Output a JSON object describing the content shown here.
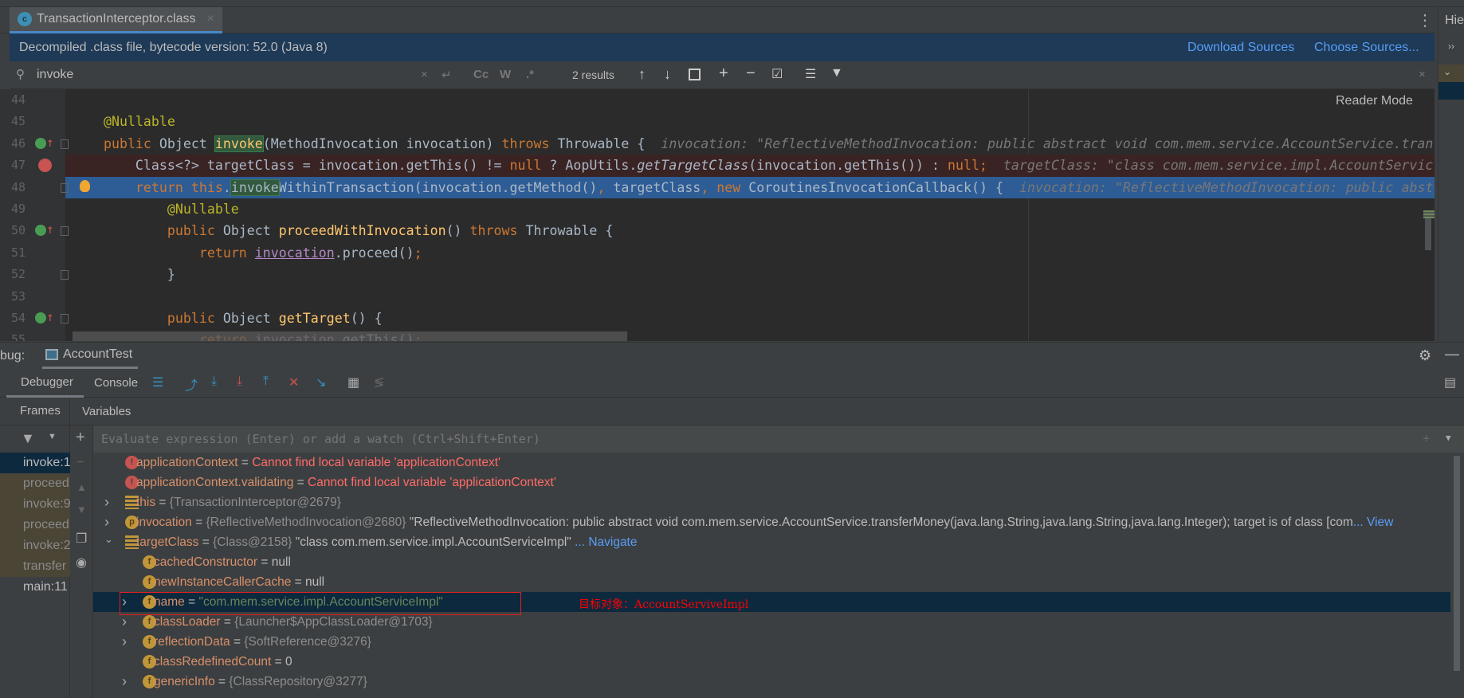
{
  "editor": {
    "tab_label": "TransactionInterceptor.class",
    "tab_close": "×",
    "info": "Decompiled .class file, bytecode version: 52.0 (Java 8)",
    "download_sources": "Download Sources",
    "choose_sources": "Choose Sources...",
    "search_value": "invoke",
    "search_results": "2 results",
    "match_case": "Cc",
    "words": "W",
    "regex": ".*",
    "reader_mode": "Reader Mode",
    "lines": [
      {
        "n": "44",
        "tokens": []
      },
      {
        "n": "45",
        "tokens": [
          {
            "c": "ann",
            "v": "    @Nullable"
          }
        ]
      },
      {
        "n": "46",
        "icon": "implements",
        "fold": true,
        "tokens": [
          {
            "c": "tx",
            "v": "    "
          },
          {
            "c": "kw",
            "v": "public "
          },
          {
            "c": "tx",
            "v": "Object "
          },
          {
            "c": "fn hl",
            "v": "invoke"
          },
          {
            "c": "tx",
            "v": "(MethodInvocation invocation) "
          },
          {
            "c": "kw",
            "v": "throws "
          },
          {
            "c": "tx",
            "v": "Throwable {"
          }
        ],
        "hint": "invocation: \"ReflectiveMethodInvocation: public abstract void com.mem.service.AccountService.tran"
      },
      {
        "n": "47",
        "icon": "breakpoint",
        "bg": "#3a2323",
        "tokens": [
          {
            "c": "tx",
            "v": "        Class<?> targetClass = invocation.getThis() != "
          },
          {
            "c": "kw",
            "v": "null"
          },
          {
            "c": "tx",
            "v": " ? AopUtils."
          },
          {
            "c": "it",
            "v": "getTargetClass"
          },
          {
            "c": "tx",
            "v": "(invocation.getThis()) : "
          },
          {
            "c": "kw",
            "v": "null;"
          }
        ],
        "hint": "targetClass: \"class com.mem.service.impl.AccountServic"
      },
      {
        "n": "48",
        "icon": "bulb",
        "fold": true,
        "bg": "#2e5c95",
        "tokens": [
          {
            "c": "tx",
            "v": "        "
          },
          {
            "c": "kw",
            "v": "return this"
          },
          {
            "c": "tx",
            "v": "."
          },
          {
            "c": "tx hl",
            "v": "invoke"
          },
          {
            "c": "tx",
            "v": "WithinTransaction(invocation.getMethod()"
          },
          {
            "c": "kw",
            "v": ", "
          },
          {
            "c": "tx",
            "v": "targetClass"
          },
          {
            "c": "kw",
            "v": ", new "
          },
          {
            "c": "tx",
            "v": "CoroutinesInvocationCallback() {"
          }
        ],
        "hint": "invocation: \"ReflectiveMethodInvocation: public abst"
      },
      {
        "n": "49",
        "tokens": [
          {
            "c": "ann",
            "v": "            @Nullable"
          }
        ]
      },
      {
        "n": "50",
        "icon": "implements",
        "fold": true,
        "tokens": [
          {
            "c": "tx",
            "v": "            "
          },
          {
            "c": "kw",
            "v": "public "
          },
          {
            "c": "tx",
            "v": "Object "
          },
          {
            "c": "fn",
            "v": "proceedWithInvocation"
          },
          {
            "c": "tx",
            "v": "() "
          },
          {
            "c": "kw",
            "v": "throws "
          },
          {
            "c": "tx",
            "v": "Throwable {"
          }
        ]
      },
      {
        "n": "51",
        "tokens": [
          {
            "c": "tx",
            "v": "                "
          },
          {
            "c": "kw",
            "v": "return "
          },
          {
            "c": "pu",
            "v": "invocation"
          },
          {
            "c": "tx",
            "v": ".proceed()"
          },
          {
            "c": "kw",
            "v": ";"
          }
        ]
      },
      {
        "n": "52",
        "fold": true,
        "tokens": [
          {
            "c": "tx",
            "v": "            }"
          }
        ]
      },
      {
        "n": "53",
        "tokens": []
      },
      {
        "n": "54",
        "icon": "implements",
        "fold": true,
        "tokens": [
          {
            "c": "tx",
            "v": "            "
          },
          {
            "c": "kw",
            "v": "public "
          },
          {
            "c": "tx",
            "v": "Object "
          },
          {
            "c": "fn",
            "v": "getTarget"
          },
          {
            "c": "tx",
            "v": "() {"
          }
        ]
      },
      {
        "n": "55",
        "tokens": [
          {
            "c": "tx",
            "v": "                "
          },
          {
            "c": "kw",
            "v": "return "
          },
          {
            "c": "pu",
            "v": "invocation"
          },
          {
            "c": "tx",
            "v": ".getThis()"
          },
          {
            "c": "kw",
            "v": ";"
          }
        ]
      }
    ]
  },
  "right_panel": {
    "title": "Hie",
    "chevrons": "››"
  },
  "debug": {
    "label": "bug:",
    "session_tab": "AccountTest",
    "tabs": [
      "Debugger",
      "Console"
    ],
    "frames_tab": "Frames",
    "variables_tab": "Variables",
    "eval_placeholder": "Evaluate expression (Enter) or add a watch (Ctrl+Shift+Enter)",
    "frames": [
      {
        "label": "invoke:1",
        "state": "selected"
      },
      {
        "label": "proceed",
        "state": "lib"
      },
      {
        "label": "invoke:9",
        "state": "lib"
      },
      {
        "label": "proceed",
        "state": "lib"
      },
      {
        "label": "invoke:2",
        "state": "lib"
      },
      {
        "label": "transfer",
        "state": "lib"
      },
      {
        "label": "main:11",
        "state": "normal"
      }
    ],
    "variables": [
      {
        "level": 0,
        "expand": "none",
        "icon": "error",
        "name": "applicationContext",
        "value": "Cannot find local variable 'applicationContext'",
        "vt": "verr"
      },
      {
        "level": 0,
        "expand": "none",
        "icon": "error",
        "name": "applicationContext.validating",
        "value": "Cannot find local variable 'applicationContext'",
        "vt": "verr"
      },
      {
        "level": 0,
        "expand": "collapsed",
        "icon": "list",
        "name": "this",
        "value": "{TransactionInterceptor@2679}",
        "vt": "vgray"
      },
      {
        "level": 0,
        "expand": "collapsed",
        "icon": "param",
        "name": "invocation",
        "value": "{ReflectiveMethodInvocation@2680}",
        "vt": "vgray",
        "extra": " \"ReflectiveMethodInvocation: public abstract void com.mem.service.AccountService.transferMoney(java.lang.String,java.lang.String,java.lang.Integer); target is of class [com",
        "link": "... View"
      },
      {
        "level": 0,
        "expand": "expanded",
        "icon": "list",
        "name": "targetClass",
        "value": "{Class@2158}",
        "vt": "vgray",
        "extra": " \"class com.mem.service.impl.AccountServiceImpl\"",
        "link": " ... Navigate"
      },
      {
        "level": 1,
        "expand": "none",
        "icon": "field",
        "name": "cachedConstructor",
        "value": "null",
        "vt": "vplain"
      },
      {
        "level": 1,
        "expand": "none",
        "icon": "field",
        "name": "newInstanceCallerCache",
        "value": "null",
        "vt": "vplain"
      },
      {
        "level": 1,
        "expand": "collapsed",
        "icon": "field",
        "name": "name",
        "value": "\"com.mem.service.impl.AccountServiceImpl\"",
        "vt": "vstr",
        "selected": true
      },
      {
        "level": 1,
        "expand": "collapsed",
        "icon": "field",
        "name": "classLoader",
        "value": "{Launcher$AppClassLoader@1703}",
        "vt": "vgray"
      },
      {
        "level": 1,
        "expand": "collapsed",
        "icon": "field",
        "name": "reflectionData",
        "value": "{SoftReference@3276}",
        "vt": "vgray"
      },
      {
        "level": 1,
        "expand": "none",
        "icon": "field",
        "name": "classRedefinedCount",
        "value": "0",
        "vt": "vplain"
      },
      {
        "level": 1,
        "expand": "collapsed",
        "icon": "field",
        "name": "genericInfo",
        "value": "{ClassRepository@3277}",
        "vt": "vgray"
      }
    ],
    "annotation": "目标对象：AccountServiveImpl",
    "annotation_color": "#ff0000"
  }
}
